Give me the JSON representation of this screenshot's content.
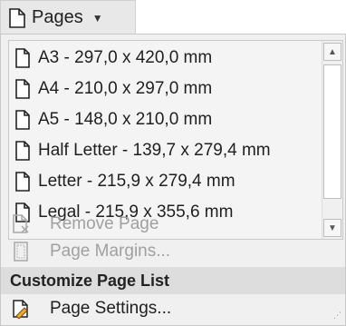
{
  "toolbar": {
    "pages_label": "Pages",
    "pages_icon": "page-icon",
    "caret_icon": "chevron-down-icon"
  },
  "page_list": {
    "items": [
      {
        "label": "A3 - 297,0 x 420,0 mm",
        "icon": "page-icon"
      },
      {
        "label": "A4 - 210,0 x 297,0 mm",
        "icon": "page-icon"
      },
      {
        "label": "A5 - 148,0 x 210,0 mm",
        "icon": "page-icon"
      },
      {
        "label": "Half Letter - 139,7 x 279,4 mm",
        "icon": "page-icon"
      },
      {
        "label": "Letter - 215,9 x 279,4 mm",
        "icon": "page-icon"
      },
      {
        "label": "Legal - 215,9 x 355,6 mm",
        "icon": "page-icon"
      }
    ],
    "scroll_up_icon": "scroll-up-arrow-icon",
    "scroll_down_icon": "scroll-down-arrow-icon"
  },
  "menu": {
    "remove_page": {
      "label": "Remove Page",
      "icon": "remove-page-icon",
      "enabled": false
    },
    "page_margins": {
      "label": "Page Margins...",
      "icon": "page-margins-icon",
      "enabled": false
    },
    "section_header": "Customize Page List",
    "page_settings": {
      "label": "Page Settings...",
      "icon": "page-settings-icon",
      "enabled": true
    }
  },
  "colors": {
    "panel_bg": "#f0f0f0",
    "header_bg": "#dddddd",
    "disabled_text": "#a0a0a0",
    "text": "#1f1f1f",
    "settings_icon_accent": "#f0a830"
  }
}
